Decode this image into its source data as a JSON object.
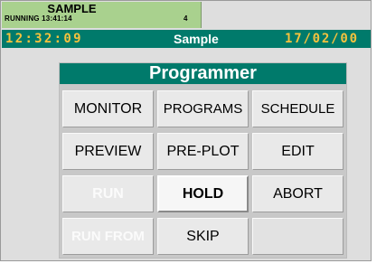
{
  "status": {
    "name": "SAMPLE",
    "line": "RUNNING 13:41:14",
    "count": "4"
  },
  "titlebar": {
    "time": "12:32:09",
    "name": "Sample",
    "date": "17/02/00"
  },
  "panel": {
    "title": "Programmer",
    "buttons": {
      "monitor": "MONITOR",
      "programs": "PROGRAMS",
      "schedule": "SCHEDULE",
      "preview": "PREVIEW",
      "preplot": "PRE-PLOT",
      "edit": "EDIT",
      "run": "RUN",
      "hold": "HOLD",
      "abort": "ABORT",
      "runfrom": "RUN FROM",
      "skip": "SKIP"
    }
  },
  "colors": {
    "header_teal": "#007a6b",
    "status_green": "#a9d18e",
    "clock_amber": "#f6c23e",
    "disabled_text": "#fbfbfb"
  }
}
